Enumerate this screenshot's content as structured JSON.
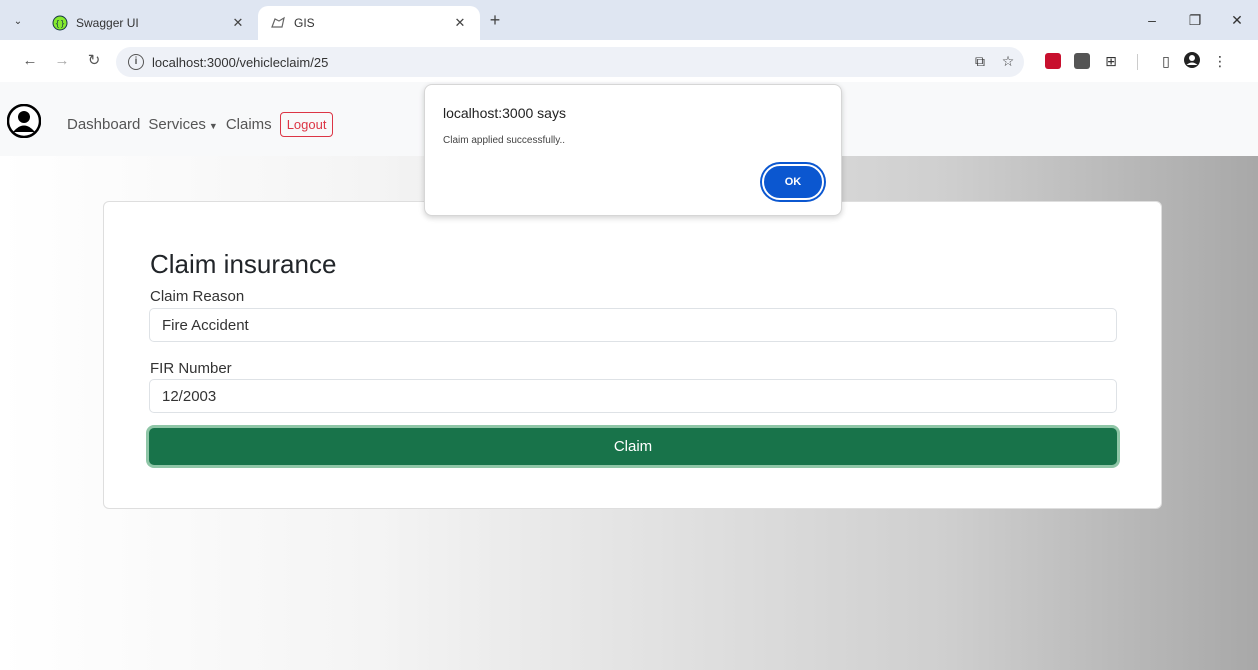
{
  "browser": {
    "tabs": [
      {
        "title": "Swagger UI",
        "active": false
      },
      {
        "title": "GIS",
        "active": true
      }
    ],
    "url": "localhost:3000/vehicleclaim/25",
    "window_controls": {
      "minimize": "–",
      "maximize": "❐",
      "close": "✕"
    }
  },
  "nav": {
    "dashboard": "Dashboard",
    "services": "Services",
    "claims": "Claims",
    "logout": "Logout"
  },
  "form": {
    "title": "Claim insurance",
    "claim_reason_label": "Claim Reason",
    "claim_reason_value": "Fire Accident",
    "fir_label": "FIR Number",
    "fir_value": "12/2003",
    "submit_label": "Claim"
  },
  "dialog": {
    "title": "localhost:3000 says",
    "message": "Claim applied successfully..",
    "ok_label": "OK"
  },
  "colors": {
    "claim_button": "#18734a",
    "logout_border": "#dc3545",
    "dialog_ok": "#0b57d0"
  }
}
